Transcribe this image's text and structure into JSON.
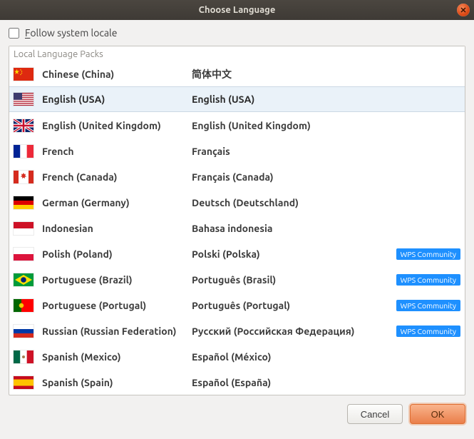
{
  "window": {
    "title": "Choose Language",
    "close_glyph": "✕"
  },
  "follow_locale": {
    "label_prefix": "F",
    "label_rest": "ollow system locale",
    "checked": false
  },
  "panel": {
    "title": "Local Language Packs"
  },
  "badge_label": "WPS Community",
  "languages": [
    {
      "id": "zh-cn",
      "name": "Chinese (China)",
      "native": "简体中文",
      "flag": "cn",
      "selected": false,
      "badge": false
    },
    {
      "id": "en-us",
      "name": "English (USA)",
      "native": "English (USA)",
      "flag": "us",
      "selected": true,
      "badge": false
    },
    {
      "id": "en-gb",
      "name": "English (United Kingdom)",
      "native": "English (United Kingdom)",
      "flag": "gb",
      "selected": false,
      "badge": false
    },
    {
      "id": "fr",
      "name": "French",
      "native": "Français",
      "flag": "fr",
      "selected": false,
      "badge": false
    },
    {
      "id": "fr-ca",
      "name": "French (Canada)",
      "native": "Français (Canada)",
      "flag": "ca",
      "selected": false,
      "badge": false
    },
    {
      "id": "de",
      "name": "German (Germany)",
      "native": "Deutsch (Deutschland)",
      "flag": "de",
      "selected": false,
      "badge": false
    },
    {
      "id": "id",
      "name": "Indonesian",
      "native": "Bahasa indonesia",
      "flag": "id",
      "selected": false,
      "badge": false
    },
    {
      "id": "pl",
      "name": "Polish (Poland)",
      "native": "Polski (Polska)",
      "flag": "pl",
      "selected": false,
      "badge": true
    },
    {
      "id": "pt-br",
      "name": "Portuguese (Brazil)",
      "native": "Português (Brasil)",
      "flag": "br",
      "selected": false,
      "badge": true
    },
    {
      "id": "pt-pt",
      "name": "Portuguese (Portugal)",
      "native": "Português (Portugal)",
      "flag": "pt",
      "selected": false,
      "badge": true
    },
    {
      "id": "ru",
      "name": "Russian (Russian Federation)",
      "native": "Русский (Российская Федерация)",
      "flag": "ru",
      "selected": false,
      "badge": true
    },
    {
      "id": "es-mx",
      "name": "Spanish (Mexico)",
      "native": "Español (México)",
      "flag": "mx",
      "selected": false,
      "badge": false
    },
    {
      "id": "es-es",
      "name": "Spanish (Spain)",
      "native": "Español (España)",
      "flag": "es",
      "selected": false,
      "badge": false
    }
  ],
  "buttons": {
    "cancel": "Cancel",
    "ok": "OK"
  }
}
